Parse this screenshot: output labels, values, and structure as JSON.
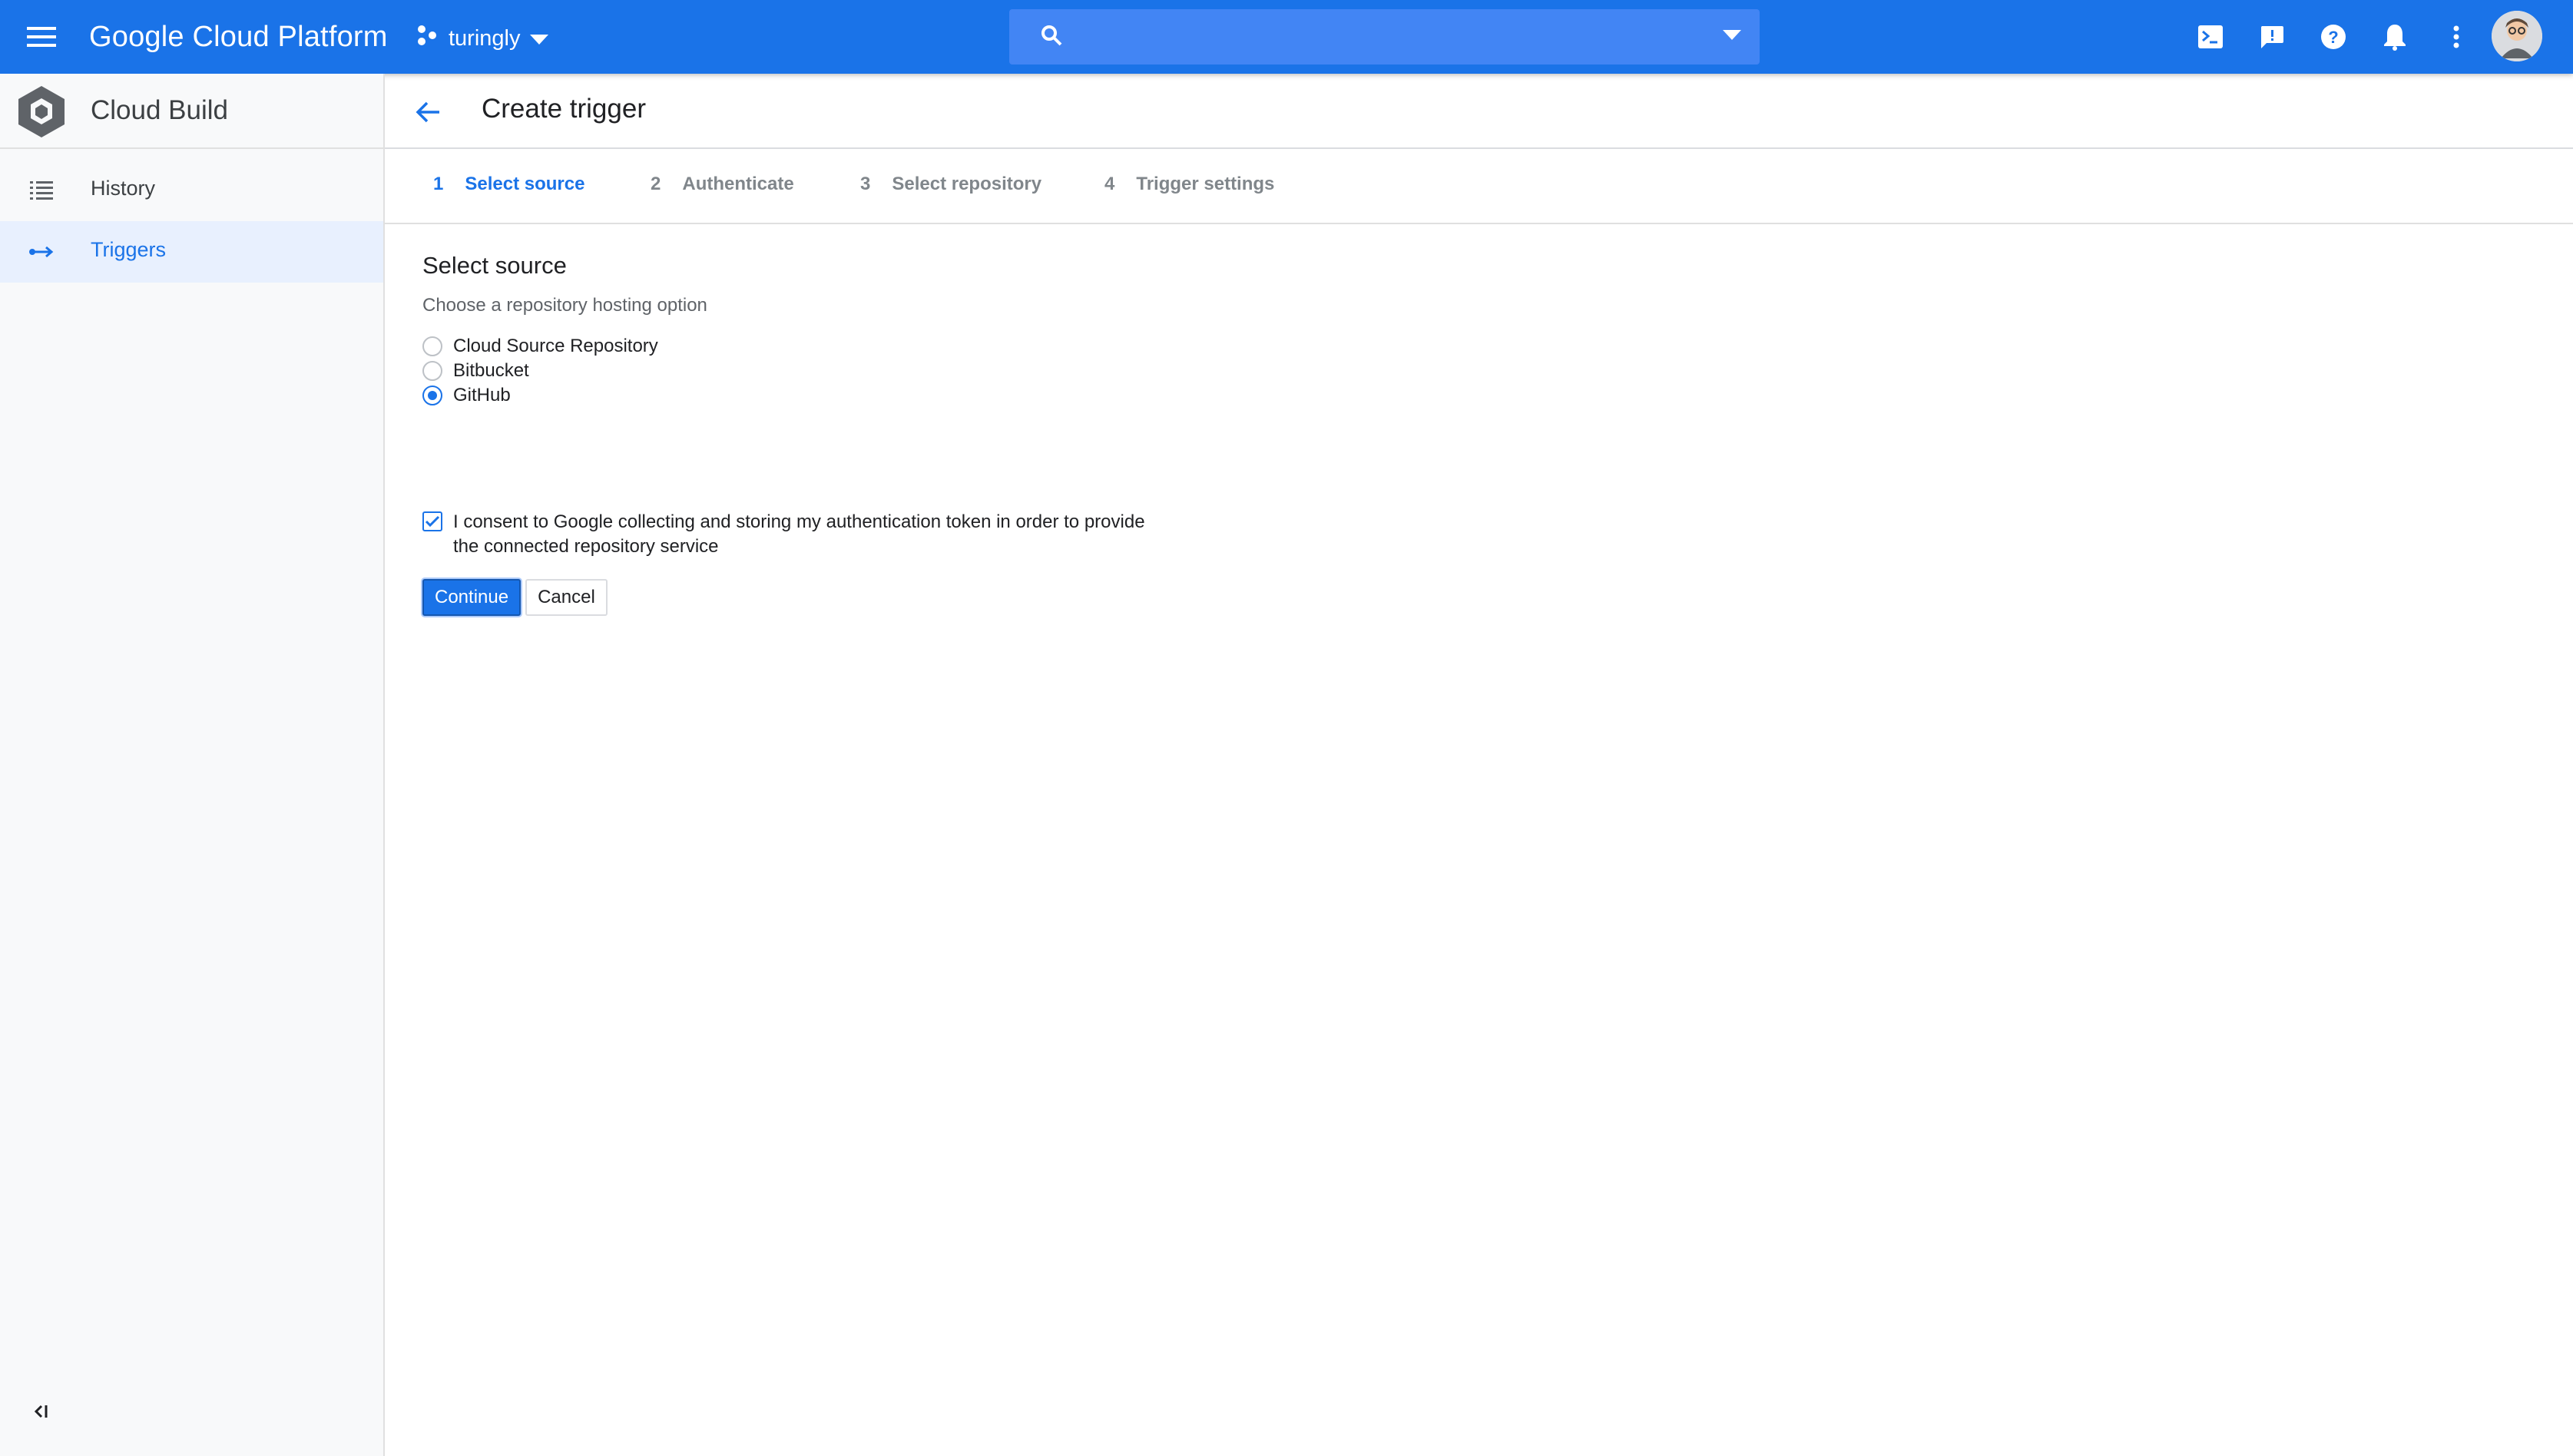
{
  "topbar": {
    "brand": "Google Cloud Platform",
    "project": "turingly",
    "search_placeholder": "",
    "icons": [
      "menu-icon",
      "project-icon",
      "search-icon",
      "dropdown-icon",
      "cloud-shell-icon",
      "feedback-icon",
      "help-icon",
      "notifications-icon",
      "more-vert-icon",
      "avatar"
    ],
    "accent_color": "#1a73e8"
  },
  "sidebar": {
    "product_name": "Cloud Build",
    "items": [
      {
        "label": "History",
        "icon": "list-icon",
        "active": false
      },
      {
        "label": "Triggers",
        "icon": "triggers-icon",
        "active": true
      }
    ]
  },
  "page": {
    "title": "Create trigger",
    "steps": [
      {
        "num": "1",
        "label": "Select source",
        "active": true
      },
      {
        "num": "2",
        "label": "Authenticate",
        "active": false
      },
      {
        "num": "3",
        "label": "Select repository",
        "active": false
      },
      {
        "num": "4",
        "label": "Trigger settings",
        "active": false
      }
    ]
  },
  "form": {
    "section_title": "Select source",
    "subtitle": "Choose a repository hosting option",
    "options": [
      {
        "label": "Cloud Source Repository",
        "selected": false
      },
      {
        "label": "Bitbucket",
        "selected": false
      },
      {
        "label": "GitHub",
        "selected": true
      }
    ],
    "consent": {
      "checked": true,
      "text": "I consent to Google collecting and storing my authentication token in order to provide the connected repository service"
    },
    "continue_label": "Continue",
    "cancel_label": "Cancel"
  }
}
